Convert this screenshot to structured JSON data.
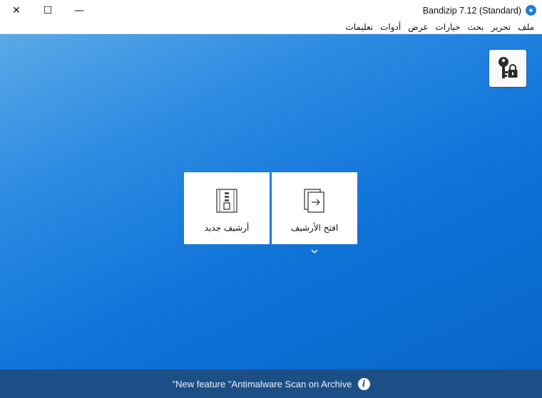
{
  "window": {
    "title": "Bandizip 7.12 (Standard)",
    "close_glyph": "✕",
    "maximize_glyph": "☐",
    "minimize_glyph": "—"
  },
  "menu": {
    "items": [
      "ملف",
      "تحرير",
      "بحث",
      "خيارات",
      "عرض",
      "أدوات",
      "تعليمات"
    ]
  },
  "main": {
    "new_archive_label": "أرشيف جديد",
    "open_archive_label": "افتح الأرشيف"
  },
  "status": {
    "text": "\"New feature \"Antimalware Scan on Archive",
    "info_glyph": "i"
  },
  "colors": {
    "accent": "#1d7fd6",
    "status_bar": "#1c4f86",
    "main_gradient_start": "#5aa9e6",
    "main_gradient_end": "#0866c8"
  },
  "icons": {
    "app": "bandizip-app-icon",
    "password": "key-lock-icon",
    "new_archive": "zip-file-icon",
    "open_archive": "open-file-icon",
    "chevron": "chevron-down-icon",
    "info": "info-icon"
  }
}
